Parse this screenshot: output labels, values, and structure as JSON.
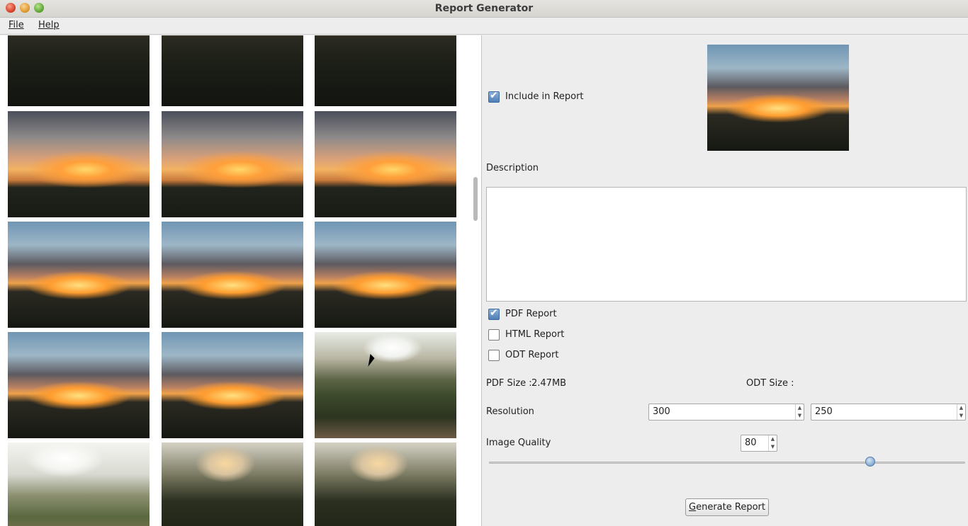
{
  "window": {
    "title": "Report Generator"
  },
  "menu": {
    "items": [
      "File",
      "Help"
    ]
  },
  "gallery": {
    "thumbnails": [
      {
        "style": "sunset-top"
      },
      {
        "style": "sunset-top"
      },
      {
        "style": "sunset-top"
      },
      {
        "style": "sunset-cloud"
      },
      {
        "style": "sunset-cloud"
      },
      {
        "style": "sunset-cloud"
      },
      {
        "style": "sunset-blue"
      },
      {
        "style": "sunset-blue"
      },
      {
        "style": "sunset-blue"
      },
      {
        "style": "sunset-blue"
      },
      {
        "style": "sunset-blue"
      },
      {
        "style": "forest"
      },
      {
        "style": "forest-bright"
      },
      {
        "style": "forest-dusk"
      },
      {
        "style": "forest-dusk"
      }
    ]
  },
  "details": {
    "include_label": "Include in Report",
    "include_checked": true,
    "description_label": "Description",
    "description_value": ""
  },
  "reports": {
    "pdf_label": "PDF Report",
    "pdf_checked": true,
    "html_label": "HTML Report",
    "html_checked": false,
    "odt_label": "ODT Report",
    "odt_checked": false
  },
  "sizes": {
    "pdf_label": "PDF Size :",
    "pdf_value": "2.47MB",
    "odt_label": "ODT Size :",
    "odt_value": ""
  },
  "resolution": {
    "label": "Resolution",
    "width": "300",
    "height": "250"
  },
  "quality": {
    "label": "Image Quality",
    "value": "80",
    "slider_fraction": 0.8
  },
  "actions": {
    "generate_label": "Generate Report"
  }
}
